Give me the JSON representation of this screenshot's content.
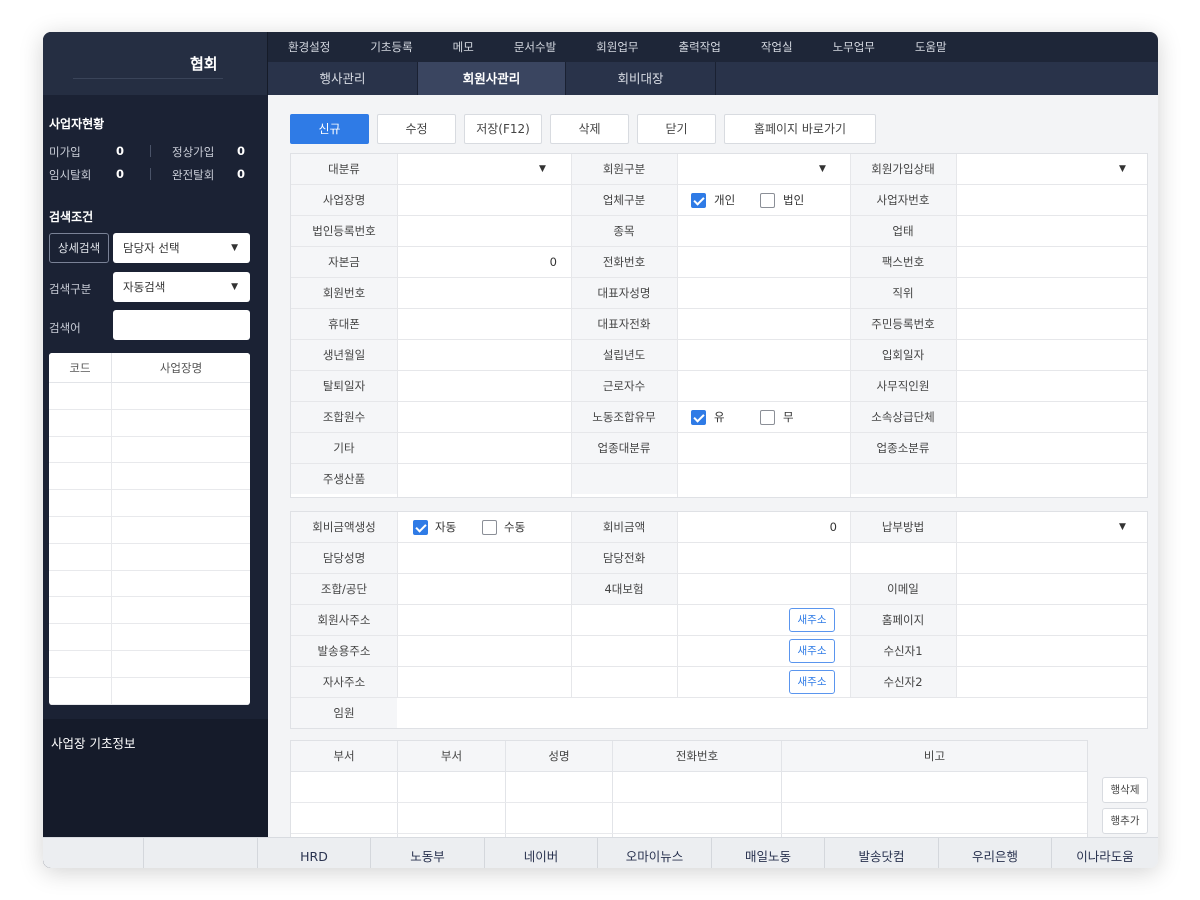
{
  "header": {
    "org_title": "협회",
    "menu": [
      "환경설정",
      "기초등록",
      "메모",
      "문서수발",
      "회원업무",
      "출력작업",
      "작업실",
      "노무업무",
      "도움말"
    ],
    "subtabs": [
      "행사관리",
      "회원사관리",
      "회비대장"
    ]
  },
  "sidebar": {
    "status_title": "사업자현황",
    "stats": [
      {
        "label": "미가입",
        "value": "0"
      },
      {
        "label": "정상가입",
        "value": "0"
      },
      {
        "label": "임시탈회",
        "value": "0"
      },
      {
        "label": "완전탈회",
        "value": "0"
      }
    ],
    "search_title": "검색조건",
    "detail_search": "상세검색",
    "manager_select": "담당자 선택",
    "search_type_label": "검색구분",
    "search_type_value": "자동검색",
    "keyword_label": "검색어",
    "grid_headers": [
      "코드",
      "사업장명"
    ],
    "basic_info": "사업장 기초정보"
  },
  "toolbar": [
    "신규",
    "수정",
    "저장(F12)",
    "삭제",
    "닫기",
    "홈페이지 바로가기"
  ],
  "form1": {
    "rows": [
      [
        "대분류",
        "회원구분",
        "회원가입상태"
      ],
      [
        "사업장명",
        "업체구분",
        "사업자번호"
      ],
      [
        "법인등록번호",
        "종목",
        "업태"
      ],
      [
        "자본금",
        "전화번호",
        "팩스번호"
      ],
      [
        "회원번호",
        "대표자성명",
        "직위"
      ],
      [
        "휴대폰",
        "대표자전화",
        "주민등록번호"
      ],
      [
        "생년월일",
        "설립년도",
        "입회일자"
      ],
      [
        "탈퇴일자",
        "근로자수",
        "사무직인원"
      ],
      [
        "조합원수",
        "노동조합유무",
        "소속상급단체"
      ],
      [
        "기타",
        "업종대분류",
        "업종소분류"
      ],
      [
        "주생산품",
        "",
        ""
      ]
    ],
    "capital_value": "0",
    "company_type_options": [
      "개인",
      "법인"
    ],
    "union_options": [
      "유",
      "무"
    ]
  },
  "form2": {
    "fee_create_label": "회비금액생성",
    "fee_create_options": [
      "자동",
      "수동"
    ],
    "fee_amount_label": "회비금액",
    "fee_amount_value": "0",
    "payment_label": "납부방법",
    "manager_name": "담당성명",
    "manager_phone": "담당전화",
    "union_org": "조합/공단",
    "insurance": "4대보험",
    "email": "이메일",
    "member_addr": "회원사주소",
    "homepage": "홈페이지",
    "mail_addr": "발송용주소",
    "recipient1": "수신자1",
    "own_addr": "자사주소",
    "recipient2": "수신자2",
    "officer": "임원",
    "new_addr_btn": "새주소"
  },
  "dept_table": {
    "headers": [
      "부서",
      "부서",
      "성명",
      "전화번호",
      "비고"
    ],
    "delete_row": "행삭제",
    "add_row": "행추가"
  },
  "bottom_links": [
    "HRD",
    "노동부",
    "네이버",
    "오마이뉴스",
    "매일노동",
    "발송닷컴",
    "우리은행",
    "이나라도움"
  ]
}
